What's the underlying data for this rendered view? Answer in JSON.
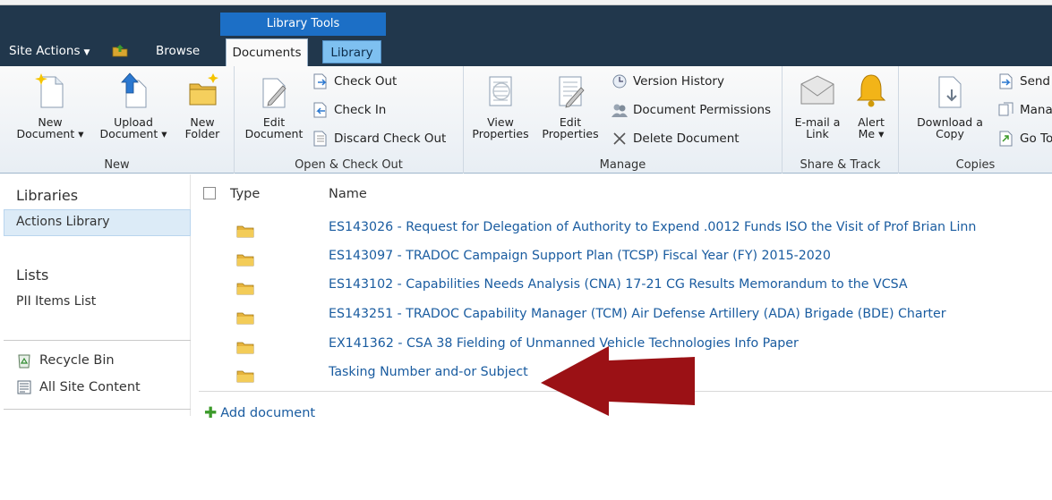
{
  "ribbon_tabs": {
    "site_actions": "Site Actions",
    "browse": "Browse",
    "contextual_group": "Library Tools",
    "documents": "Documents",
    "library": "Library"
  },
  "ribbon": {
    "new_group": {
      "label": "New",
      "new_document": [
        "New",
        "Document"
      ],
      "upload_document": [
        "Upload",
        "Document"
      ],
      "new_folder": [
        "New",
        "Folder"
      ]
    },
    "open_group": {
      "label": "Open & Check Out",
      "edit_document": [
        "Edit",
        "Document"
      ],
      "check_out": "Check Out",
      "check_in": "Check In",
      "discard_check_out": "Discard Check Out"
    },
    "manage_group": {
      "label": "Manage",
      "view_properties": [
        "View",
        "Properties"
      ],
      "edit_properties": [
        "Edit",
        "Properties"
      ],
      "version_history": "Version History",
      "document_permissions": "Document Permissions",
      "delete_document": "Delete Document"
    },
    "share_group": {
      "label": "Share & Track",
      "email_link": [
        "E-mail a",
        "Link"
      ],
      "alert_me": [
        "Alert",
        "Me"
      ]
    },
    "copies_group": {
      "label": "Copies",
      "download_copy": [
        "Download a",
        "Copy"
      ],
      "send_to": "Send",
      "manage_copies": "Mana",
      "go_to_source": "Go To"
    }
  },
  "leftnav": {
    "libraries_heading": "Libraries",
    "actions_library": "Actions Library",
    "lists_heading": "Lists",
    "pii_items_list": "PII Items List",
    "recycle_bin": "Recycle Bin",
    "all_site_content": "All Site Content"
  },
  "list": {
    "col_type": "Type",
    "col_name": "Name",
    "rows": [
      "ES143026 - Request for Delegation of Authority to Expend .0012 Funds ISO the Visit of Prof Brian Linn",
      "ES143097 - TRADOC Campaign Support Plan (TCSP) Fiscal Year (FY) 2015-2020",
      "ES143102 - Capabilities Needs Analysis (CNA) 17-21 CG Results Memorandum to the VCSA",
      "ES143251 - TRADOC Capability Manager (TCM) Air Defense Artillery (ADA) Brigade (BDE) Charter",
      "EX141362 - CSA 38 Fielding of Unmanned Vehicle Technologies Info Paper",
      "Tasking Number and-or Subject"
    ],
    "add_document": "Add document"
  },
  "colors": {
    "top_band": "#21374c",
    "library_tools": "#1c6fc6",
    "link": "#1a5ca0",
    "annotation_arrow": "#9b1115"
  }
}
